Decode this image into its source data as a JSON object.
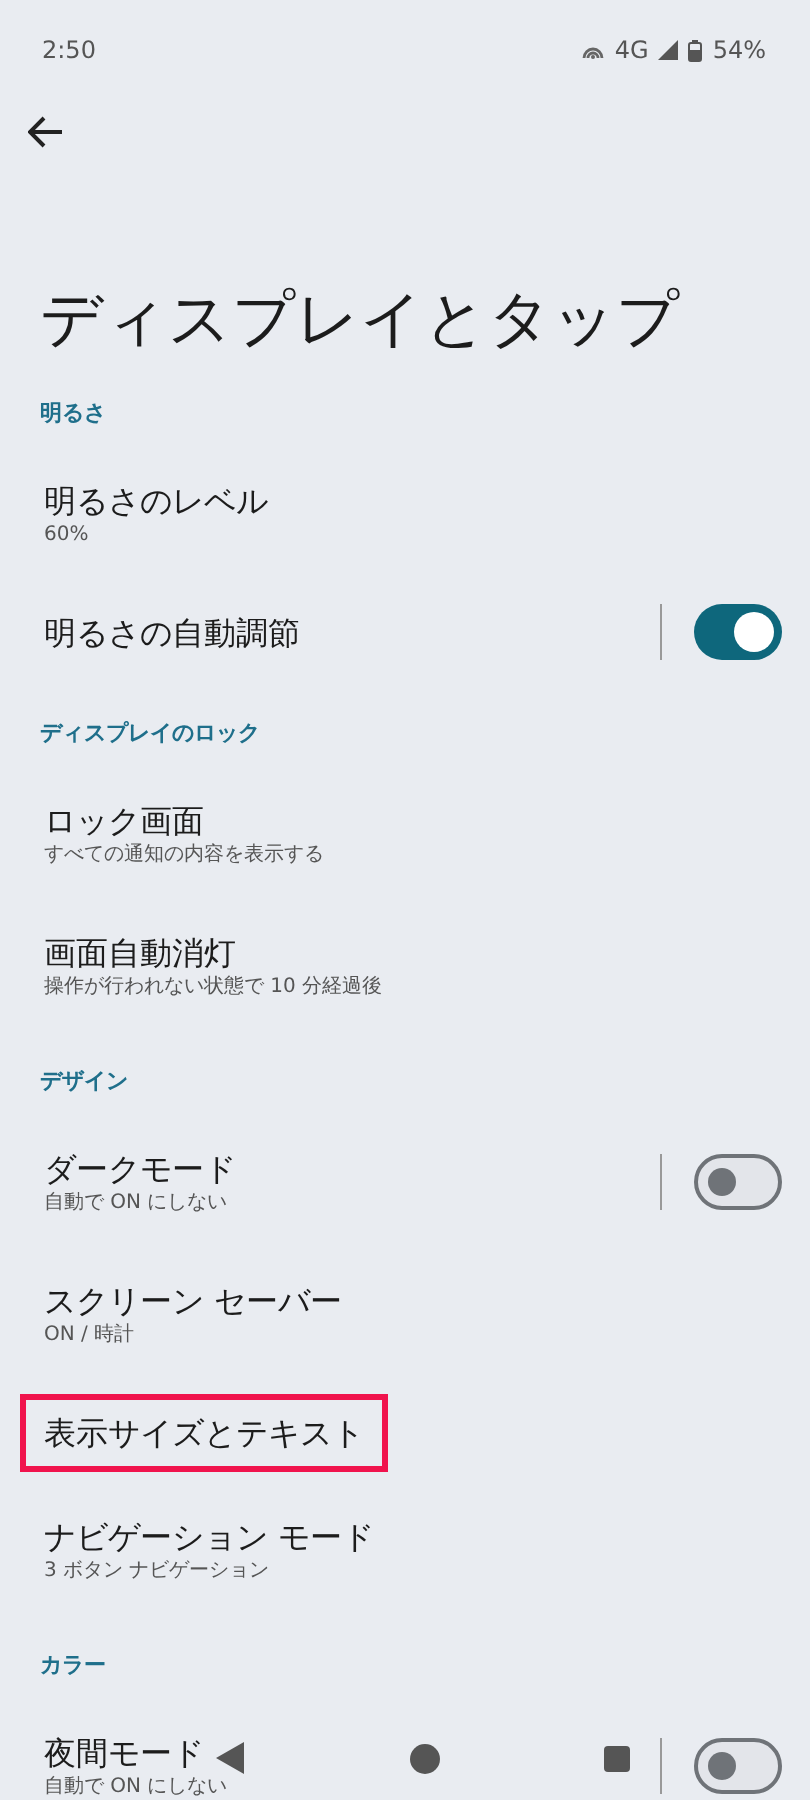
{
  "status_bar": {
    "time": "2:50",
    "network": "4G",
    "battery": "54%"
  },
  "title": "ディスプレイとタップ",
  "sections": [
    {
      "header": "明るさ",
      "items": [
        {
          "kind": "plain",
          "title": "明るさのレベル",
          "subtitle": "60%",
          "highlighted": false
        },
        {
          "kind": "toggle",
          "title": "明るさの自動調節",
          "on": true,
          "highlighted": false
        }
      ]
    },
    {
      "header": "ディスプレイのロック",
      "items": [
        {
          "kind": "plain",
          "title": "ロック画面",
          "subtitle": "すべての通知の内容を表示する",
          "highlighted": false
        },
        {
          "kind": "plain",
          "title": "画面自動消灯",
          "subtitle": "操作が行われない状態で 10 分経過後",
          "highlighted": false
        }
      ]
    },
    {
      "header": "デザイン",
      "items": [
        {
          "kind": "toggle",
          "title": "ダークモード",
          "subtitle": "自動で ON にしない",
          "on": false,
          "highlighted": false
        },
        {
          "kind": "plain",
          "title": "スクリーン セーバー",
          "subtitle": "ON / 時計",
          "highlighted": false
        },
        {
          "kind": "plain",
          "title": "表示サイズとテキスト",
          "highlighted": true
        },
        {
          "kind": "plain",
          "title": "ナビゲーション モード",
          "subtitle": "3 ボタン ナビゲーション",
          "highlighted": false
        }
      ]
    },
    {
      "header": "カラー",
      "items": [
        {
          "kind": "toggle",
          "title": "夜間モード",
          "subtitle": "自動で ON にしない",
          "on": false,
          "highlighted": false
        }
      ]
    }
  ]
}
